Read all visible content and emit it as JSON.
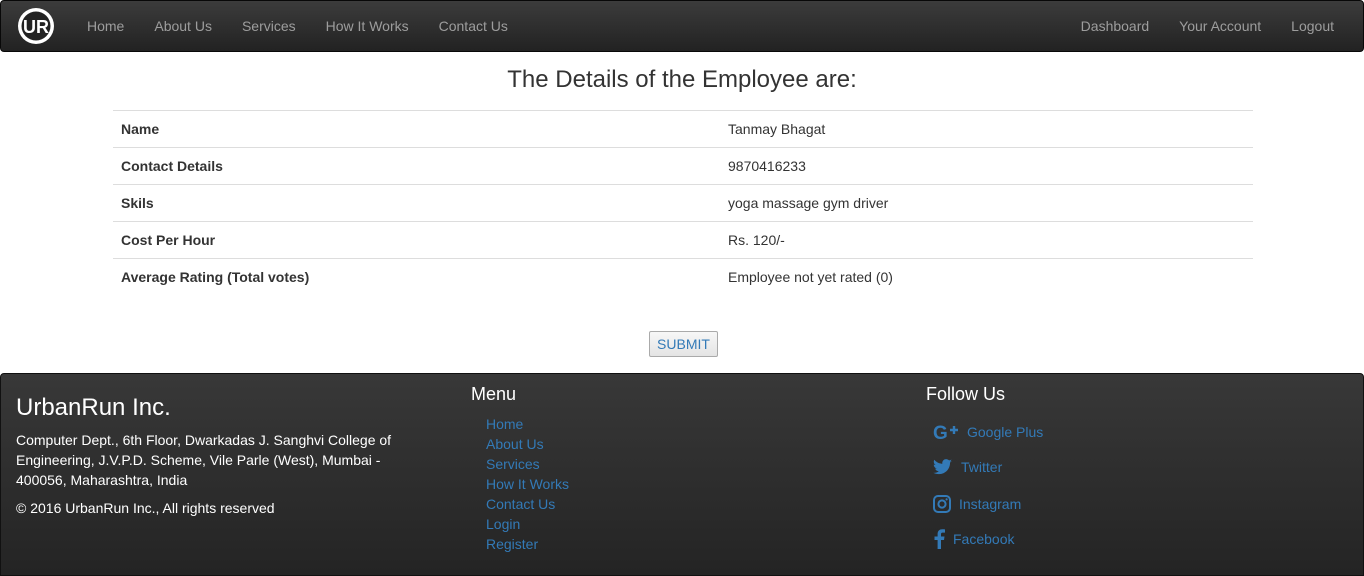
{
  "nav": {
    "logo_text": "UR",
    "left_items": [
      "Home",
      "About Us",
      "Services",
      "How It Works",
      "Contact Us"
    ],
    "right_items": [
      "Dashboard",
      "Your Account",
      "Logout"
    ]
  },
  "main": {
    "title": "The Details of the Employee are:",
    "rows": [
      {
        "label": "Name",
        "value": "Tanmay Bhagat"
      },
      {
        "label": "Contact Details",
        "value": "9870416233"
      },
      {
        "label": "Skils",
        "value": "yoga massage gym driver"
      },
      {
        "label": "Cost Per Hour",
        "value": "Rs. 120/-"
      },
      {
        "label": "Average Rating (Total votes)",
        "value": "Employee not yet rated (0)"
      }
    ],
    "submit_label": "SUBMIT"
  },
  "footer": {
    "company": "UrbanRun Inc.",
    "address": "Computer Dept., 6th Floor, Dwarkadas J. Sanghvi College of Engineering, J.V.P.D. Scheme, Vile Parle (West), Mumbai - 400056, Maharashtra, India",
    "copyright": "© 2016 UrbanRun Inc., All rights reserved",
    "menu_title": "Menu",
    "menu_items": [
      "Home",
      "About Us",
      "Services",
      "How It Works",
      "Contact Us",
      "Login",
      "Register"
    ],
    "follow_title": "Follow Us",
    "social": [
      {
        "label": "Google Plus",
        "icon": "google-plus-icon"
      },
      {
        "label": "Twitter",
        "icon": "twitter-icon"
      },
      {
        "label": "Instagram",
        "icon": "instagram-icon"
      },
      {
        "label": "Facebook",
        "icon": "facebook-icon"
      }
    ]
  },
  "colors": {
    "navbar_bg": "#222222",
    "nav_link": "#9d9d9d",
    "link_blue": "#337ab7",
    "footer_bg": "#2e2e2e"
  }
}
